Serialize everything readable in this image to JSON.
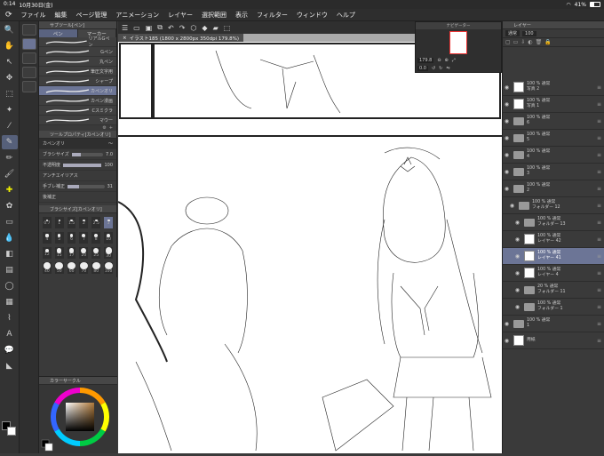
{
  "status": {
    "time": "0:14",
    "date": "10月30日(金)",
    "battery": "41%",
    "battery_fill": 0.41
  },
  "menu": [
    "ファイル",
    "編集",
    "ページ管理",
    "アニメーション",
    "レイヤー",
    "選択範囲",
    "表示",
    "フィルター",
    "ウィンドウ",
    "ヘルプ"
  ],
  "document": {
    "tab_title": "イラスト185 (1800 x 2800px 350dpi 179.8%)"
  },
  "subtool": {
    "header": "サブツール[ペン]",
    "tabs": [
      "ペン",
      "マーカー"
    ],
    "brushes": [
      "リアルGペン",
      "Gペン",
      "丸ペン",
      "筆圧文字用",
      "シャープ",
      "カペンオリ",
      "カペン漫画",
      "Cスミクラ",
      "マウー"
    ],
    "selected_index": 5
  },
  "toolprop": {
    "header": "ツールプロパティ[カペンオリ]",
    "name": "カペンオリ",
    "rows": [
      {
        "label": "ブラシサイズ",
        "value": "7.0",
        "fill": 0.3
      },
      {
        "label": "不透明度",
        "value": "100",
        "fill": 1.0
      },
      {
        "label": "アンチエイリアス",
        "value": ""
      },
      {
        "label": "手ブレ補正",
        "value": "31",
        "fill": 0.31
      },
      {
        "label": "後補正",
        "value": ""
      }
    ]
  },
  "brushsize": {
    "header": "ブラシサイズ[カペンオリ]",
    "sizes": [
      "0.7",
      "1",
      "1.5",
      "2",
      "2.5",
      "3",
      "4",
      "5",
      "6",
      "7",
      "8",
      "10",
      "12",
      "15",
      "17",
      "20",
      "25",
      "30",
      "40",
      "50",
      "60",
      "70",
      "80",
      "100"
    ],
    "selected": "3"
  },
  "colorcircle": {
    "header": "カラーサークル"
  },
  "navigator": {
    "header": "ナビゲーター",
    "zoom": "179.8",
    "angle": "0.0"
  },
  "layers": {
    "header": "レイヤー",
    "blend": "通常",
    "opacity": "100",
    "items": [
      {
        "label": "100 % 通常\n写真 2",
        "type": "layer",
        "sel": false,
        "indent": 0
      },
      {
        "label": "100 % 通常\n写真 1",
        "type": "layer",
        "sel": false,
        "indent": 0
      },
      {
        "label": "100 % 通常\n6",
        "type": "folder",
        "sel": false,
        "indent": 0
      },
      {
        "label": "100 % 通常\n5",
        "type": "folder",
        "sel": false,
        "indent": 0
      },
      {
        "label": "100 % 通常\n4",
        "type": "folder",
        "sel": false,
        "indent": 0
      },
      {
        "label": "100 % 通常\n3",
        "type": "folder",
        "sel": false,
        "indent": 0
      },
      {
        "label": "100 % 通常\n2",
        "type": "folder",
        "sel": false,
        "indent": 0
      },
      {
        "label": "100 % 通常\nフォルダー 12",
        "type": "folder",
        "sel": false,
        "indent": 1
      },
      {
        "label": "100 % 通常\nフォルダー 13",
        "type": "folder",
        "sel": false,
        "indent": 2
      },
      {
        "label": "100 % 通常\nレイヤー 42",
        "type": "layer",
        "sel": false,
        "indent": 2
      },
      {
        "label": "100 % 通常\nレイヤー 41",
        "type": "layer",
        "sel": true,
        "indent": 2
      },
      {
        "label": "100 % 通常\nレイヤー 4",
        "type": "layer",
        "sel": false,
        "indent": 2
      },
      {
        "label": "20 % 通常\nフォルダー 11",
        "type": "folder",
        "sel": false,
        "indent": 2
      },
      {
        "label": "100 % 通常\nフォルダー 1",
        "type": "folder",
        "sel": false,
        "indent": 2
      },
      {
        "label": "100 % 通常\n1",
        "type": "folder",
        "sel": false,
        "indent": 0
      },
      {
        "label": "用紙",
        "type": "layer",
        "sel": false,
        "indent": 0
      }
    ]
  },
  "accent": "#6c7596"
}
